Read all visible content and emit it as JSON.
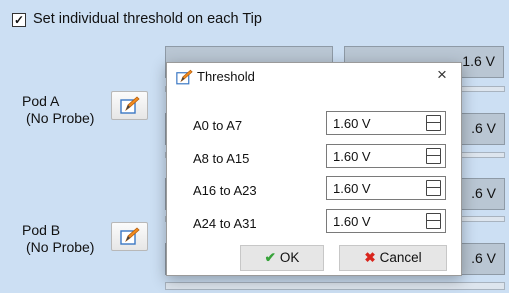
{
  "options": {
    "individual_threshold_label": "Set individual threshold on each Tip",
    "individual_threshold_checked": "✓"
  },
  "pods": [
    {
      "name": "Pod A",
      "status": "(No Probe)"
    },
    {
      "name": "Pod B",
      "status": "(No Probe)"
    }
  ],
  "background_buttons": {
    "a8_a15_value": "A8 to A15: 1.6 V",
    "a8_a15_visible": "1.6 V",
    "a0_a7_obscured": "A0 to A7: 1.6 V",
    "row2_visible": ".6 V",
    "row3_visible": ".6 V",
    "row4_visible": ".6 V"
  },
  "dialog": {
    "title": "Threshold",
    "close_label": "×",
    "rows": [
      {
        "label": "A0 to A7",
        "value": "1.60 V"
      },
      {
        "label": "A8 to A15",
        "value": "1.60 V"
      },
      {
        "label": "A16 to A23",
        "value": "1.60 V"
      },
      {
        "label": "A24 to A31",
        "value": "1.60 V"
      }
    ],
    "ok_label": "OK",
    "ok_icon": "✔",
    "cancel_label": "Cancel",
    "cancel_icon": "✖"
  }
}
